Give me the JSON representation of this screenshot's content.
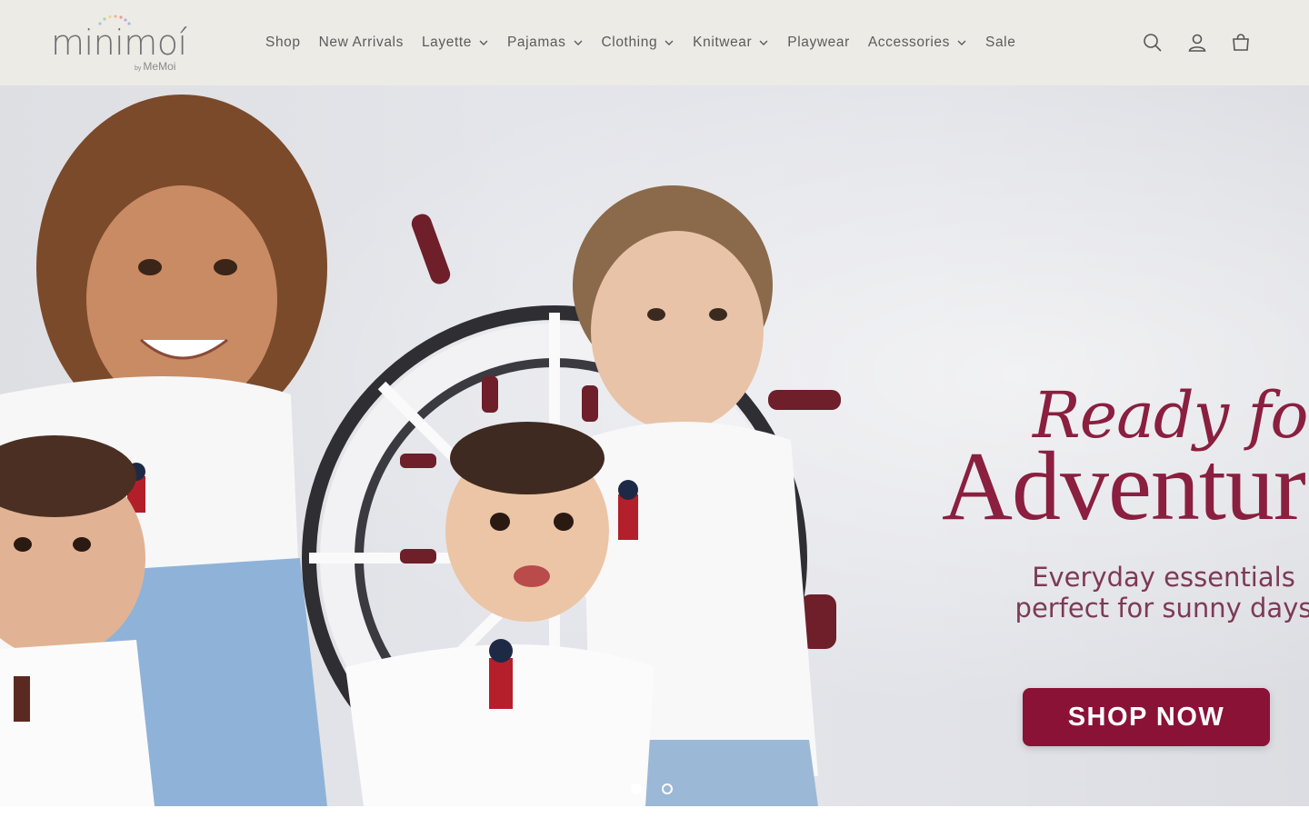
{
  "brand": {
    "name": "minimoí",
    "by_prefix": "by",
    "by_name": "MeMoi",
    "accent": "#8a1f3f",
    "header_bg": "#ecebe6"
  },
  "nav": {
    "items": [
      {
        "label": "Shop",
        "has_dropdown": false
      },
      {
        "label": "New Arrivals",
        "has_dropdown": false
      },
      {
        "label": "Layette",
        "has_dropdown": true
      },
      {
        "label": "Pajamas",
        "has_dropdown": true
      },
      {
        "label": "Clothing",
        "has_dropdown": true
      },
      {
        "label": "Knitwear",
        "has_dropdown": true
      },
      {
        "label": "Playwear",
        "has_dropdown": false
      },
      {
        "label": "Accessories",
        "has_dropdown": true
      },
      {
        "label": "Sale",
        "has_dropdown": false
      }
    ]
  },
  "header_icons": [
    "search-icon",
    "account-icon",
    "cart-icon"
  ],
  "hero": {
    "headline_line1": "Ready for",
    "headline_line2": "Adventure",
    "subline_line1": "Everyday essentials",
    "subline_line2": "perfect for sunny days",
    "cta_label": "SHOP NOW",
    "cta_color": "#8a1236",
    "slides_total": 2,
    "slide_active": 1
  }
}
